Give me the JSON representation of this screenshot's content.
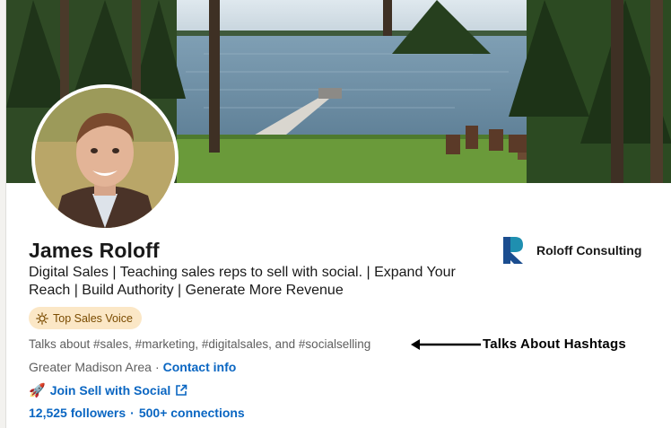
{
  "profile": {
    "name": "James Roloff",
    "headline": "Digital Sales | Teaching sales reps to sell with social. | Expand Your Reach | Build Authority | Generate More Revenue",
    "badge": "Top Sales Voice",
    "talks_about": "Talks about #sales, #marketing, #digitalsales, and #socialselling",
    "location": "Greater Madison Area",
    "contact_link": "Contact info",
    "custom_link": "Join Sell with Social",
    "followers": "12,525 followers",
    "connections": "500+ connections",
    "separator": "·"
  },
  "company": {
    "name": "Roloff Consulting",
    "logo_icon": "roloff-r-logo-icon"
  },
  "annotation": {
    "label": "Talks About Hashtags"
  },
  "icons": {
    "badge_icon": "sun-icon",
    "link_icon": "rocket-icon",
    "external_icon": "external-link-icon"
  },
  "colors": {
    "link": "#0a66c2",
    "badge_bg": "#fbe7c6",
    "badge_text": "#7a4b00"
  }
}
